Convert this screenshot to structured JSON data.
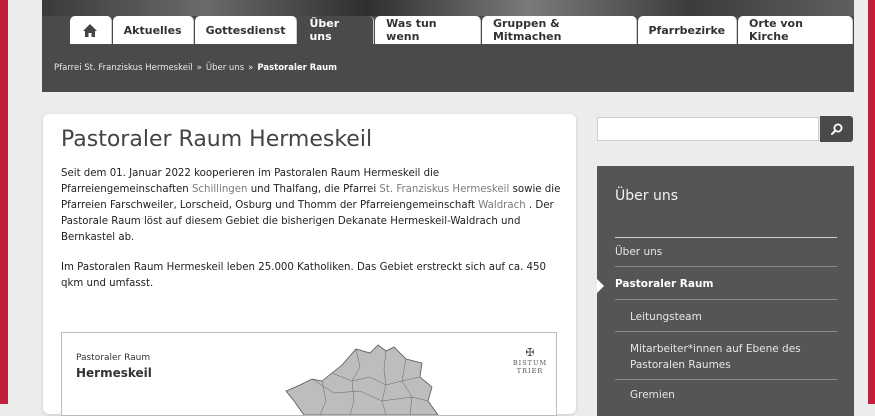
{
  "nav": {
    "home_icon": "home-icon",
    "items": [
      {
        "label": "Aktuelles"
      },
      {
        "label": "Gottesdienst"
      },
      {
        "label": "Über uns"
      },
      {
        "label": "Was tun wenn"
      },
      {
        "label": "Gruppen & Mitmachen"
      },
      {
        "label": "Pfarrbezirke"
      },
      {
        "label": "Orte von Kirche"
      }
    ]
  },
  "breadcrumb": {
    "items": [
      "Pfarrei St. Franziskus Hermeskeil",
      "Über uns",
      "Pastoraler Raum"
    ],
    "separator": "»"
  },
  "main": {
    "title": "Pastoraler Raum Hermeskeil",
    "para1": {
      "t1": "Seit dem 01. Januar 2022 kooperieren im Pastoralen Raum Hermeskeil die Pfarreiengemeinschaften ",
      "link1": "Schillingen",
      "t2": " und Thalfang, die Pfarrei ",
      "link2": "St. Franziskus Hermeskeil",
      "t3": " sowie die Pfarreien Farschweiler, Lorscheid, Osburg und Thomm der Pfarreiengemeinschaft ",
      "link3": "Waldrach",
      "t4": " . Der Pastorale Raum löst auf diesem Gebiet die bisherigen Dekanate Hermeskeil-Waldrach und Bernkastel ab."
    },
    "para2": "Im Pastoralen Raum Hermeskeil leben 25.000 Katholiken. Das Gebiet erstreckt sich auf ca. 450 qkm und umfasst.",
    "map": {
      "title_line1": "Pastoraler Raum",
      "title_line2": "Hermeskeil",
      "logo_line1": "BISTUM",
      "logo_line2": "TRIER"
    }
  },
  "search": {
    "placeholder": "",
    "value": "",
    "icon": "search-icon"
  },
  "sidebar": {
    "title": "Über uns",
    "items": [
      {
        "label": "Über uns"
      },
      {
        "label": "Pastoraler Raum"
      },
      {
        "label": "Leitungsteam"
      },
      {
        "label": "Mitarbeiter*innen auf Ebene des Pastoralen Raumes"
      },
      {
        "label": "Gremien"
      }
    ]
  },
  "colors": {
    "frame": "#c01f3a",
    "nav_active": "#4a4a4a",
    "sidebar_bg": "#555555",
    "link": "#7b7b7b"
  }
}
